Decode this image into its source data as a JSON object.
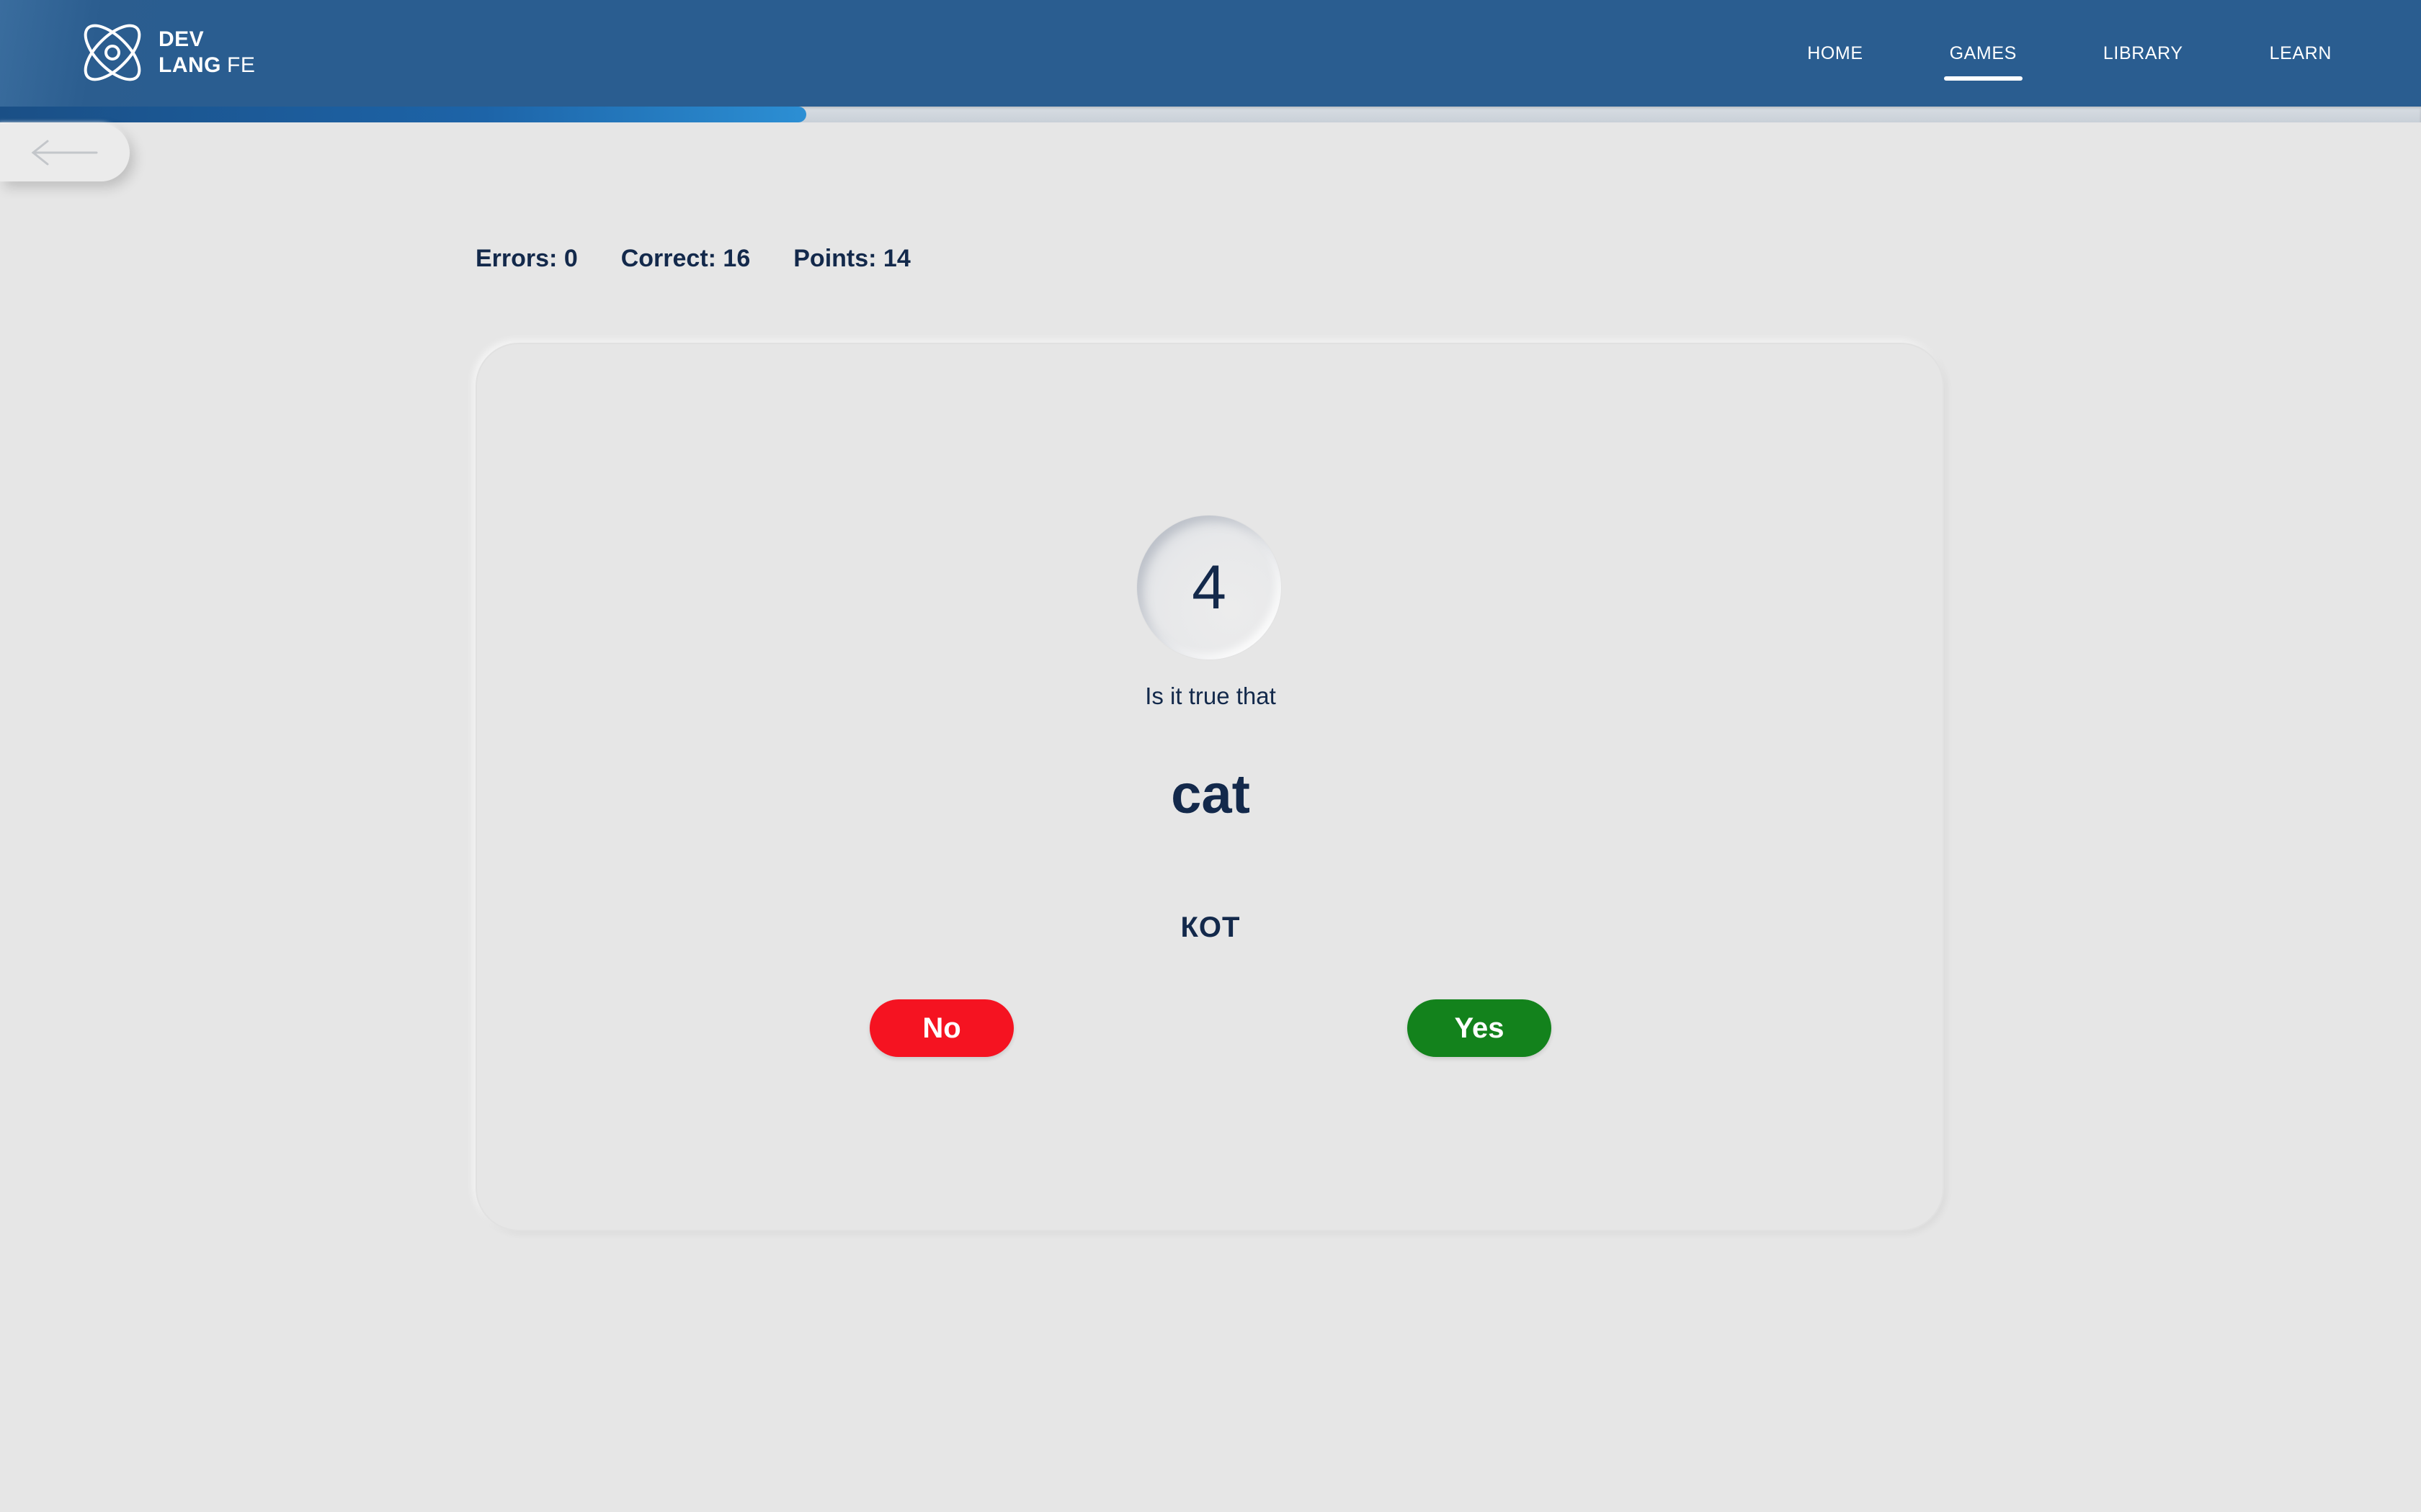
{
  "header": {
    "logo": {
      "line1": "DEV",
      "line2_strong": "LANG",
      "line2_light": "FE",
      "icon": "atom-logo-icon"
    },
    "nav": [
      {
        "label": "HOME",
        "active": false
      },
      {
        "label": "GAMES",
        "active": true
      },
      {
        "label": "LIBRARY",
        "active": false
      },
      {
        "label": "LEARN",
        "active": false
      }
    ]
  },
  "progress": {
    "fraction": 0.333
  },
  "back_button": {
    "icon": "arrow-left-icon"
  },
  "stats": {
    "errors": "Errors: 0",
    "correct": "Correct: 16",
    "points": "Points: 14"
  },
  "game": {
    "timer": "4",
    "prompt": "Is it true that",
    "word": "cat",
    "translation": "КОТ",
    "no_label": "No",
    "yes_label": "Yes"
  },
  "colors": {
    "header": "#2a5d90",
    "text": "#13294b",
    "background": "#e6e6e6",
    "no_button": "#f51321",
    "yes_button": "#13821c",
    "progress": "#1d64a8"
  }
}
